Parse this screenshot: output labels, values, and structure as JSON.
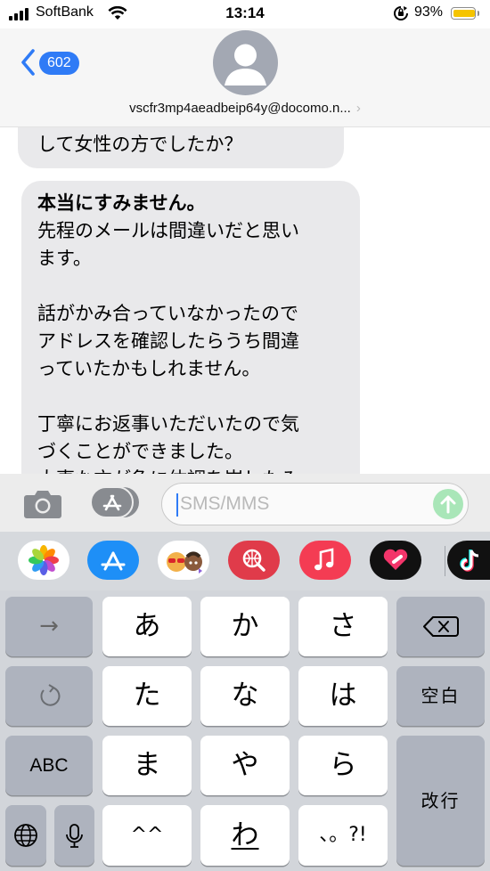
{
  "status_bar": {
    "carrier": "SoftBank",
    "time": "13:14",
    "battery_percent": "93%",
    "battery_level": 0.93
  },
  "header": {
    "back_badge": "602",
    "contact": "vscfr3mp4aeadbeip64y@docomo.n..."
  },
  "messages": [
    {
      "text": "して女性の方でしたか？"
    },
    {
      "bold": "本当にすみません。",
      "text": "先程のメールは間違いだと思い\nます。\n\n話がかみ合っていなかったので\nアドレスを確認したらうち間違\nっていたかもしれません。\n\n丁寧にお返事いただいたので気\nづくことができました。\n大事な方が急に体調を崩したみ"
    }
  ],
  "compose": {
    "placeholder": "SMS/MMS"
  },
  "app_strip": [
    "photos-icon",
    "app-store-icon",
    "memoji-icon",
    "search-globe-icon",
    "music-icon",
    "heart-app-icon",
    "tiktok-icon"
  ],
  "keyboard": {
    "arrow": "→",
    "row1": [
      "あ",
      "か",
      "さ"
    ],
    "row2": [
      "た",
      "な",
      "は"
    ],
    "row3": [
      "ま",
      "や",
      "ら"
    ],
    "row4": [
      "^^",
      "わ",
      "、。?!"
    ],
    "abc": "ABC",
    "space": "空白",
    "enter": "改行"
  }
}
